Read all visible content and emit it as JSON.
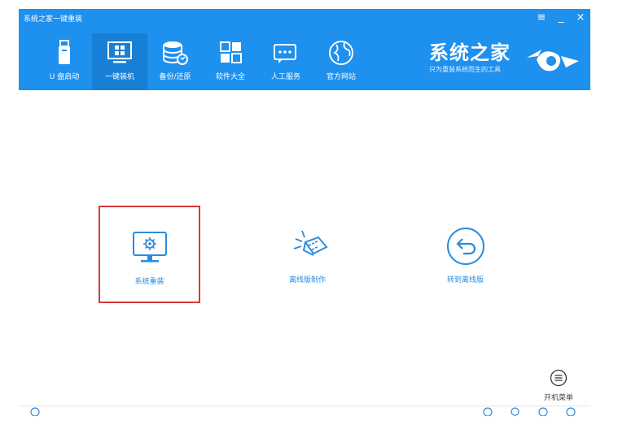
{
  "window": {
    "title": "系统之家一键重装"
  },
  "controls": {
    "menu": "≡",
    "minimize": "_",
    "close": "×"
  },
  "nav": {
    "items": [
      {
        "label": "U 盘启动",
        "icon": "usb-drive-icon"
      },
      {
        "label": "一键装机",
        "icon": "windows-monitor-icon",
        "active": true
      },
      {
        "label": "备份/还原",
        "icon": "database-restore-icon"
      },
      {
        "label": "软件大全",
        "icon": "apps-grid-icon"
      },
      {
        "label": "人工服务",
        "icon": "chat-bubble-icon"
      },
      {
        "label": "官方网站",
        "icon": "globe-icon"
      }
    ]
  },
  "brand": {
    "name": "系统之家",
    "slogan": "只为重装系统而生的工具"
  },
  "options": [
    {
      "label": "系统重装",
      "icon": "monitor-gear-icon",
      "selected": true
    },
    {
      "label": "离线版制作",
      "icon": "offline-package-icon",
      "selected": false
    },
    {
      "label": "转到离线版",
      "icon": "back-arrow-icon",
      "selected": false
    }
  ],
  "boot_menu": {
    "label": "开机菜单",
    "icon": "menu-lines-icon"
  },
  "colors": {
    "header": "#1e90ee",
    "active_tab": "#1780d6",
    "selection_border": "#d9383a",
    "accent": "#2a8be0"
  }
}
